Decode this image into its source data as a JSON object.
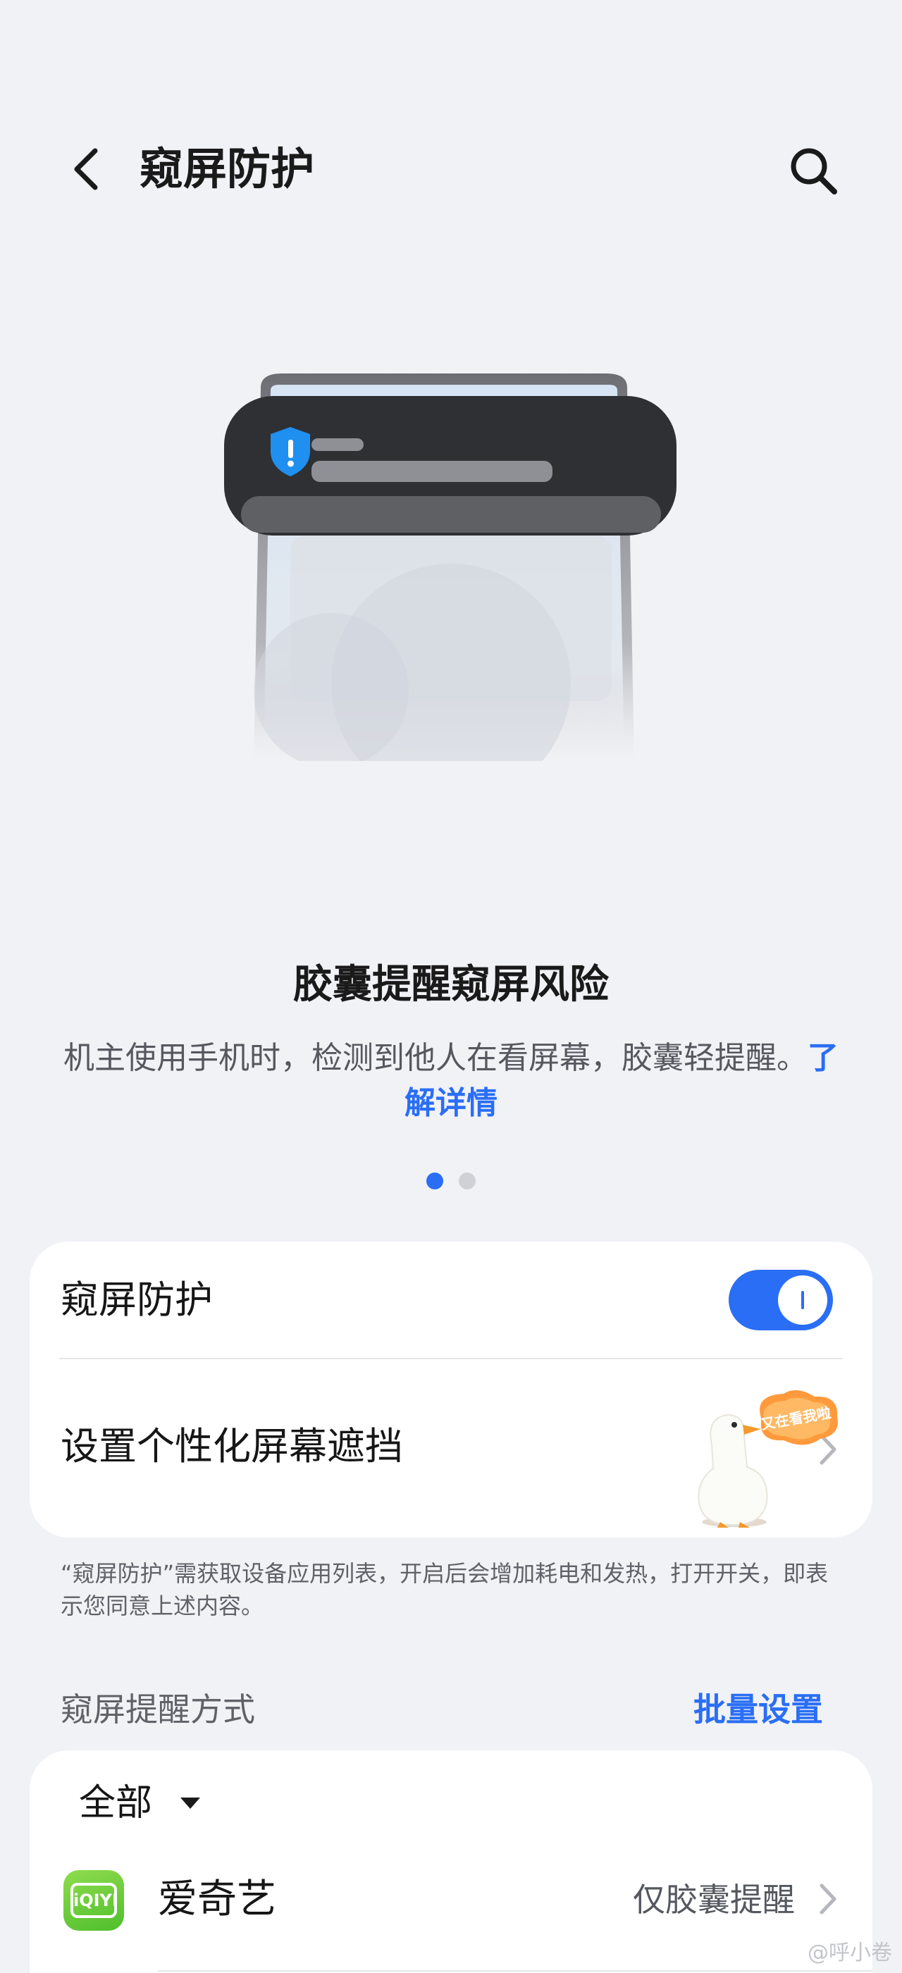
{
  "header": {
    "title": "窥屏防护",
    "back_icon": "chevron-left-icon",
    "search_icon": "search-icon"
  },
  "intro": {
    "title": "胶囊提醒窥屏风险",
    "description": "机主使用手机时，检测到他人在看屏幕，胶囊轻提醒。",
    "learn_more": "了解详情",
    "page_index": 1,
    "page_count": 2
  },
  "settings": {
    "protection_label": "窥屏防护",
    "protection_enabled": true,
    "custom_mask_label": "设置个性化屏幕遮挡",
    "mascot_bubble_text": "又在看我啦"
  },
  "note": "“窥屏防护”需获取设备应用列表，开启后会增加耗电和发热，打开开关，即表示您同意上述内容。",
  "reminder_section": {
    "label": "窥屏提醒方式",
    "batch_link": "批量设置",
    "filter_label": "全部",
    "apps": [
      {
        "name": "爱奇艺",
        "icon_text": "iQIYI",
        "mode": "仅胶囊提醒"
      }
    ]
  },
  "watermark": "@呼小卷",
  "colors": {
    "accent": "#2a6ef5",
    "background": "#f1f2f6",
    "card": "#ffffff"
  }
}
